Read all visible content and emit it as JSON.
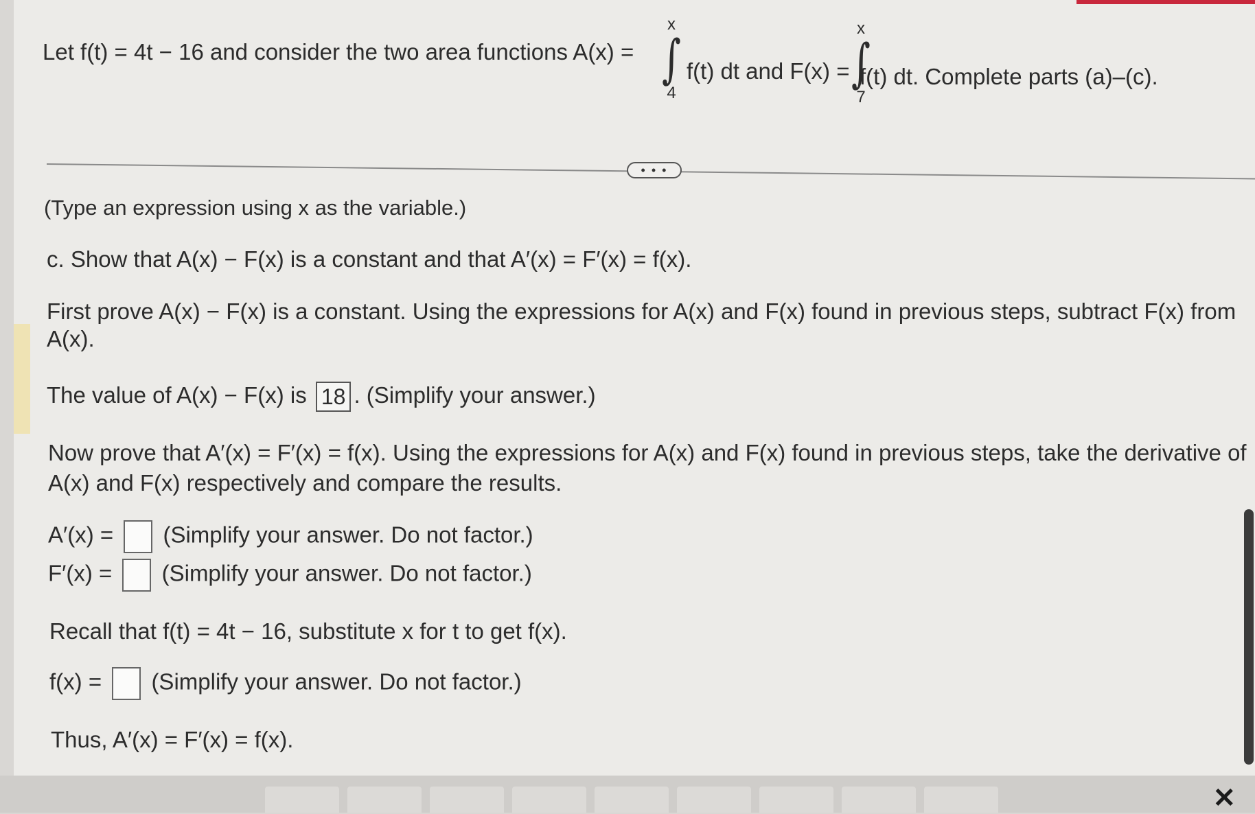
{
  "header": {
    "intro_prefix": "Let f(t) = 4t − 16 and consider the two area functions A(x) =",
    "a_upper": "x",
    "a_lower": "4",
    "mid_text": "f(t) dt and F(x) =",
    "f_upper": "x",
    "f_lower": "7",
    "suffix": "f(t) dt. Complete parts (a)–(c)."
  },
  "more_button": {
    "label": "• • •"
  },
  "body": {
    "type_hint": "(Type an expression using x as the variable.)",
    "part_c": "c. Show that A(x) − F(x) is a constant and that A′(x) = F′(x) = f(x).",
    "first_prove_line1": "First prove A(x) − F(x) is a constant. Using the expressions for A(x) and F(x) found in previous steps, subtract F(x) from",
    "first_prove_line2": "A(x).",
    "value_prefix": "The value of A(x) − F(x) is",
    "value_answer": "18",
    "value_suffix": ". (Simplify your answer.)",
    "now_prove_line1": "Now prove that A′(x) = F′(x) = f(x). Using the expressions for A(x) and F(x) found in previous steps, take the derivative of",
    "now_prove_line2": "A(x) and F(x) respectively and compare the results.",
    "a_prime_label": "A′(x) =",
    "a_prime_hint": "(Simplify your answer. Do not factor.)",
    "f_prime_label": "F′(x) =",
    "f_prime_hint": "(Simplify your answer. Do not factor.)",
    "recall": "Recall that f(t) = 4t − 16, substitute x for t to get f(x).",
    "fx_label": "f(x) =",
    "fx_hint": "(Simplify your answer. Do not factor.)",
    "thus": "Thus, A′(x) = F′(x) = f(x)."
  },
  "toolbar": {
    "close_icon": "close-icon"
  },
  "colors": {
    "accent": "#c8283c",
    "highlight": "#efe3b4"
  }
}
